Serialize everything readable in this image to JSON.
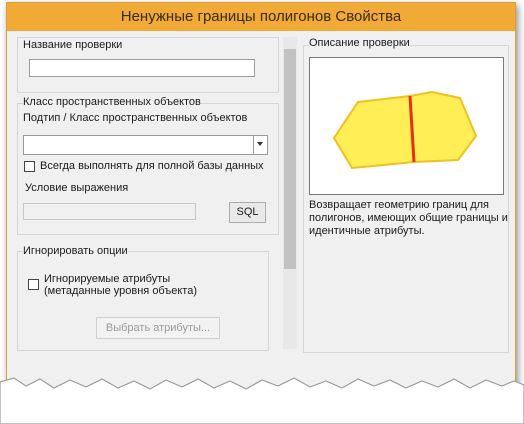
{
  "window": {
    "title": "Ненужные границы полигонов Свойства"
  },
  "check_name": {
    "label": "Название проверки",
    "value": ""
  },
  "feature_class": {
    "group_label": "Класс пространственных объектов",
    "subtype_label": "Подтип / Класс пространственных объектов",
    "subtype_value": "",
    "always_run_label": "Всегда выполнять для полной базы данных",
    "expression_label": "Условие выражения",
    "expression_value": "",
    "sql_button": "SQL"
  },
  "ignore_options": {
    "group_label": "Игнорировать опции",
    "ignored_attrs_line1": "Игнорируемые атрибуты",
    "ignored_attrs_line2": "(метаданные уровня объекта)",
    "select_attrs_button": "Выбрать атрибуты..."
  },
  "description": {
    "group_label": "Описание проверки",
    "image": "adjacent-polygons-shared-boundary",
    "line1": "Возвращает геометрию границ для",
    "line2": "полигонов, имеющих общие границы и",
    "line3": "идентичные атрибуты.",
    "colors": {
      "fill": "#ffee55",
      "outline": "#f0c020",
      "boundary": "#e83018"
    }
  }
}
